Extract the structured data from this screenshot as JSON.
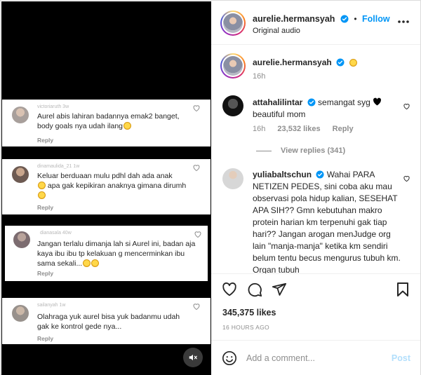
{
  "media": {
    "cards": [
      {
        "username": "victoriaruth 3w",
        "text": "Aurel abis lahiran badannya emak2 banget, body goals nya udah ilang",
        "reply": "Reply"
      },
      {
        "username": "dinamaulida_21 1w",
        "text_1": "Keluar berduaan mulu pdhl dah ada anak",
        "text_2": "apa gak kepikiran anaknya gimana dirumh",
        "reply": "Reply"
      },
      {
        "username": "dianasala 40w",
        "text": "Jangan terlalu dimanja lah si Aurel ini, badan aja kaya ibu ibu tp kelakuan g mencerminkan ibu sama sekali...",
        "reply": "Reply"
      },
      {
        "username": "sailanyah 1w",
        "text": "Olahraga yuk aurel bisa yuk badanmu udah gak ke kontrol gede nya...",
        "reply": "Reply"
      }
    ],
    "mute_icon": "speaker-muted-icon"
  },
  "header": {
    "username": "aurelie.hermansyah",
    "follow_label": "Follow",
    "audio_label": "Original audio",
    "more_icon": "more-dots-icon"
  },
  "caption": {
    "username": "aurelie.hermansyah",
    "time": "16h"
  },
  "comments": [
    {
      "username": "attahalilintar",
      "text": "semangat syg",
      "text_2": "beautiful mom",
      "time": "16h",
      "likes": "23,532 likes",
      "reply": "Reply",
      "view_replies": "View replies (341)"
    },
    {
      "username": "yuliabaltschun",
      "text": "Wahai PARA NETIZEN PEDES, sini coba aku mau observasi pola hidup kalian, SESEHAT APA SIH?? Gmn kebutuhan makro protein harian km terpenuhi gak tiap hari?? Jangan arogan menJudge org lain \"manja-manja\" ketika km sendiri belum tentu becus mengurus tubuh km. Organ tubuh"
    }
  ],
  "actions": {
    "likes": "345,375 likes",
    "time_ago": "16 HOURS AGO"
  },
  "add_comment": {
    "placeholder": "Add a comment...",
    "post_label": "Post"
  },
  "colors": {
    "accent": "#0095f6",
    "post_disabled": "#b2dffc",
    "muted": "#8e8e8e"
  }
}
